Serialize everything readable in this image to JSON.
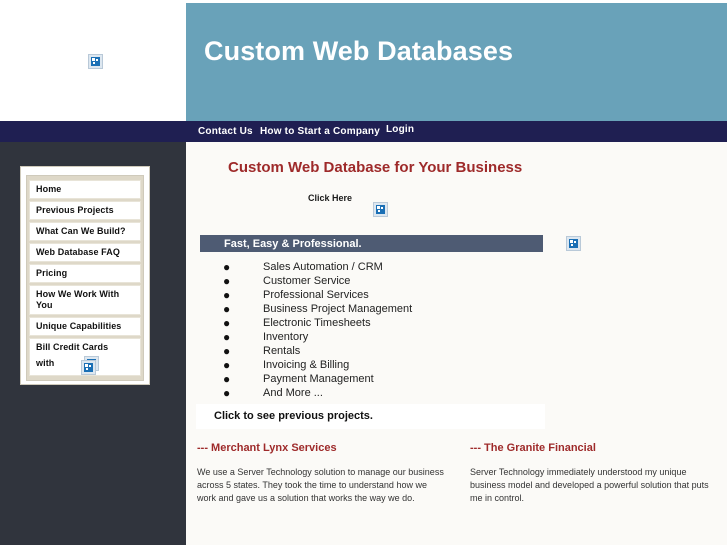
{
  "header": {
    "title": "Custom Web Databases",
    "logo_icon": "broken-image-icon",
    "band_color": "#69a2b9"
  },
  "nav": {
    "bar_color": "#1f1f52",
    "links": [
      {
        "label": "Contact Us"
      },
      {
        "label": "How to Start a Company"
      },
      {
        "label": "Login"
      }
    ]
  },
  "sidebar": {
    "background_color": "#30343d",
    "menu_background_color": "#ded8c8",
    "items": [
      {
        "label": "Home"
      },
      {
        "label": "Previous Projects"
      },
      {
        "label": "What Can We Build?"
      },
      {
        "label": "Web Database FAQ"
      },
      {
        "label": "Pricing"
      },
      {
        "label": "How We Work With You"
      },
      {
        "label": "Unique Capabilities"
      },
      {
        "label": "Bill Credit Cards",
        "label2": "with",
        "icon": "broken-image-icon"
      }
    ],
    "footer_icon": "broken-image-icon"
  },
  "main": {
    "heading": "Custom Web Database for Your Business",
    "heading_color": "#9e2a2a",
    "click_here_label": "Click Here",
    "click_here_icon": "broken-image-icon",
    "feature_bar": {
      "label": "Fast, Easy & Professional.",
      "color": "#4e5b73",
      "icon": "broken-image-icon"
    },
    "features": [
      "Sales Automation / CRM",
      "Customer Service",
      "Professional Services",
      "Business Project Management",
      "Electronic Timesheets",
      "Inventory",
      "Rentals",
      "Invoicing & Billing",
      "Payment Management",
      "And More ..."
    ],
    "previous_projects_label": "Click to see previous projects.",
    "testimonials": [
      {
        "title": "--- Merchant Lynx Services",
        "body": "We use a Server Technology solution to manage our business across 5 states. They took the time to understand how we work and gave us a solution that works the way we do."
      },
      {
        "title": "--- The Granite Financial",
        "body": "Server Technology immediately understood my unique business model and developed a powerful solution that puts me in control."
      }
    ]
  }
}
